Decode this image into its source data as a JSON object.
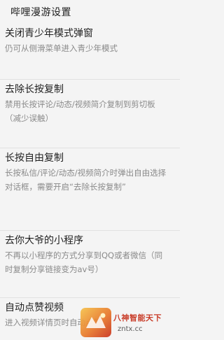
{
  "header": {
    "title": "哔哩漫游设置"
  },
  "settings": [
    {
      "title": "关闭青少年模式弹窗",
      "description": "仍可从侧滑菜单进入青少年模式"
    },
    {
      "title": "去除长按复制",
      "description": "禁用长按评论/动态/视频简介复制到剪切板（减少误触）"
    },
    {
      "title": "长按自由复制",
      "description": "长按私信/评论/动态/视频简介时弹出自由选择对话框，需要开启“去除长按复制”"
    },
    {
      "title": "去你大爷的小程序",
      "description": "不再以小程序的方式分享到QQ或者微信（同时复制分享链接变为av号）"
    },
    {
      "title": "自动点赞视频",
      "description": "进入视频详情页时自动点赞"
    }
  ],
  "watermark": {
    "name": "八神智能天下",
    "url": "zntx.cc"
  }
}
